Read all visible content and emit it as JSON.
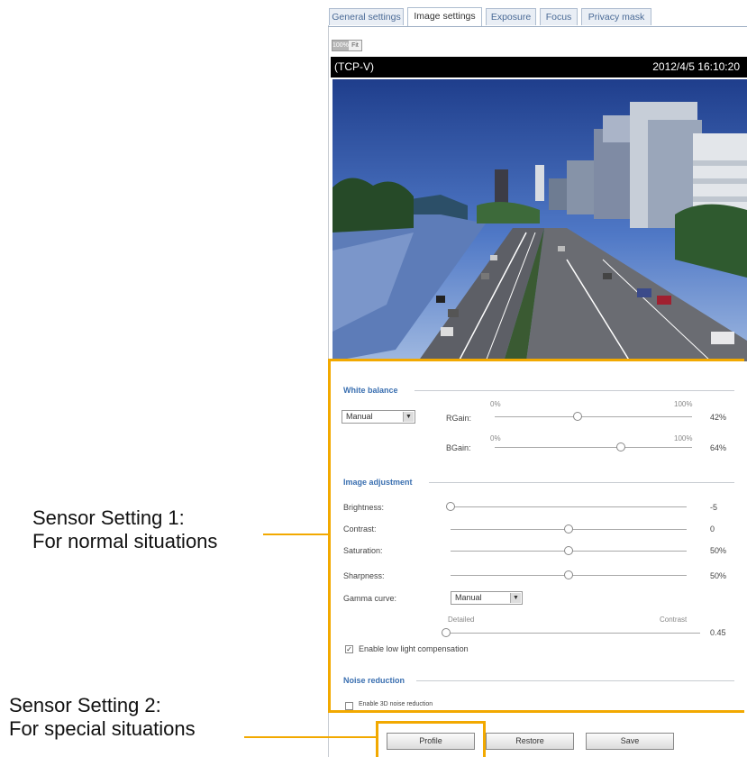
{
  "tabs": [
    "General settings",
    "Image settings",
    "Exposure",
    "Focus",
    "Privacy mask"
  ],
  "zoom": [
    "100%",
    "Fit"
  ],
  "video": {
    "stream": "(TCP-V)",
    "timestamp": "2012/4/5 16:10:20"
  },
  "white_balance": {
    "title": "White balance",
    "mode": "Manual",
    "rgain": {
      "label": "RGain:",
      "min": "0%",
      "max": "100%",
      "value": "42%",
      "level": 42
    },
    "bgain": {
      "label": "BGain:",
      "min": "0%",
      "max": "100%",
      "value": "64%",
      "level": 64
    }
  },
  "image_adjustment": {
    "title": "Image adjustment",
    "brightness": {
      "label": "Brightness:",
      "value": "-5",
      "level": 0
    },
    "contrast": {
      "label": "Contrast:",
      "value": "0",
      "level": 50
    },
    "saturation": {
      "label": "Saturation:",
      "value": "50%",
      "level": 50
    },
    "sharpness": {
      "label": "Sharpness:",
      "value": "50%",
      "level": 50
    },
    "gamma": {
      "label": "Gamma curve:",
      "mode": "Manual",
      "min": "Detailed",
      "max": "Contrast",
      "value": "0.45",
      "level": 0
    },
    "low_light": {
      "label": "Enable low light compensation",
      "checked": true
    }
  },
  "noise_reduction": {
    "title": "Noise reduction",
    "checkbox_label": "Enable 3D noise reduction",
    "checked": false
  },
  "buttons": {
    "profile": "Profile",
    "restore": "Restore",
    "save": "Save"
  },
  "annotations": {
    "sensor1": {
      "line1": "Sensor Setting 1:",
      "line2": "For normal situations"
    },
    "sensor2": {
      "line1": "Sensor Setting 2:",
      "line2": "For special situations"
    }
  },
  "colors": {
    "highlight": "#f2a900",
    "section_title": "#3a6fb0",
    "title_bar": "#000000"
  }
}
